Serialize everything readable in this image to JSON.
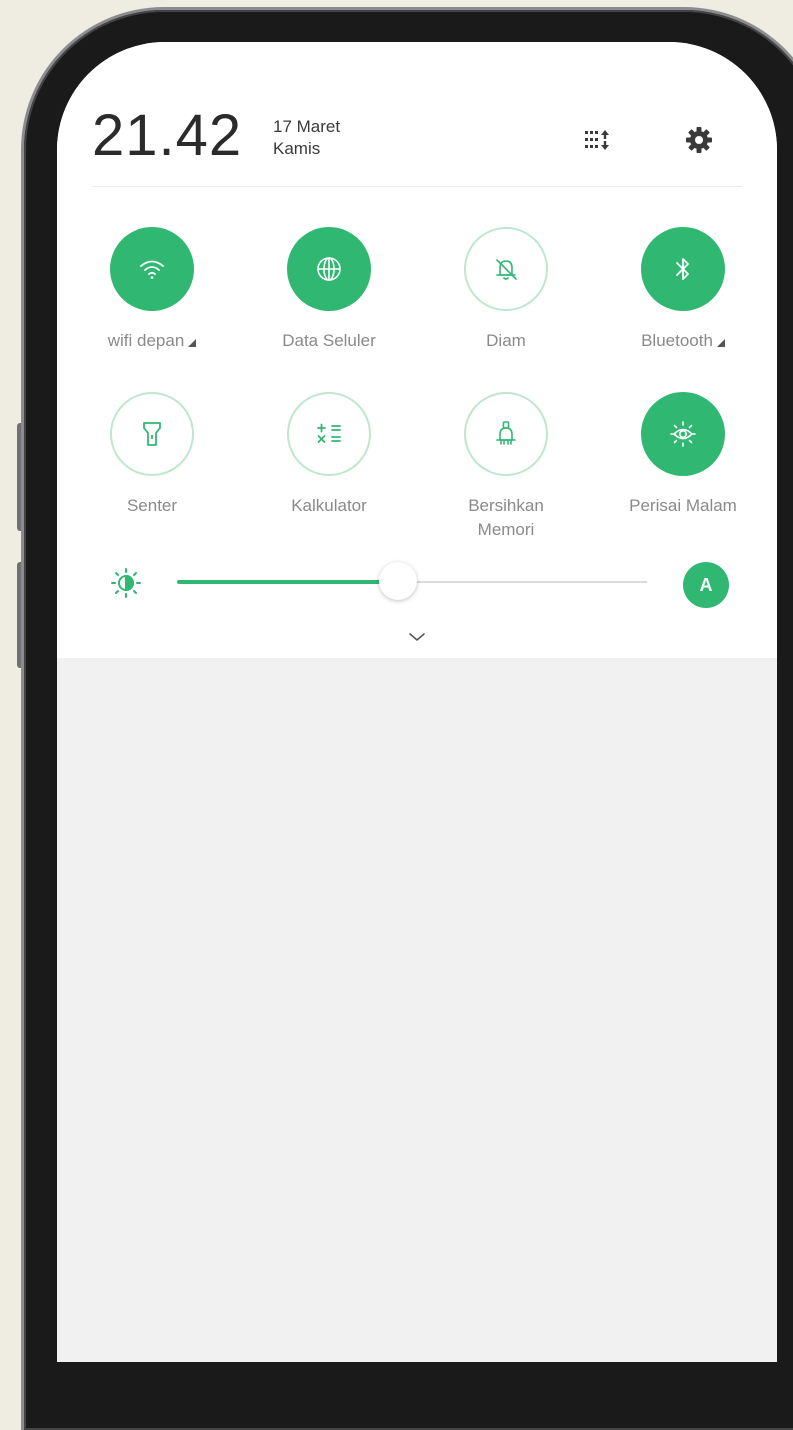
{
  "status": {
    "time": "21.42",
    "date": "17 Maret",
    "day": "Kamis"
  },
  "header_icons": [
    "edit-tiles-icon",
    "settings-icon"
  ],
  "toggles": [
    {
      "label": "wifi depan",
      "icon": "wifi-icon",
      "active": true,
      "signal": true
    },
    {
      "label": "Data Seluler",
      "icon": "globe-icon",
      "active": true,
      "signal": false
    },
    {
      "label": "Diam",
      "icon": "bell-off-icon",
      "active": false,
      "signal": false
    },
    {
      "label": "Bluetooth",
      "icon": "bluetooth-icon",
      "active": true,
      "signal": true
    },
    {
      "label": "Senter",
      "icon": "flashlight-icon",
      "active": false,
      "signal": false
    },
    {
      "label": "Kalkulator",
      "icon": "calculator-icon",
      "active": false,
      "signal": false
    },
    {
      "label": "Bersihkan\nMemori",
      "icon": "broom-icon",
      "active": false,
      "signal": false
    },
    {
      "label": "Perisai Malam",
      "icon": "eye-shield-icon",
      "active": true,
      "signal": false
    }
  ],
  "brightness": {
    "level": 0.47,
    "auto_label": "A"
  },
  "colors": {
    "accent": "#30b872",
    "accent_light": "#bfe6cf"
  }
}
